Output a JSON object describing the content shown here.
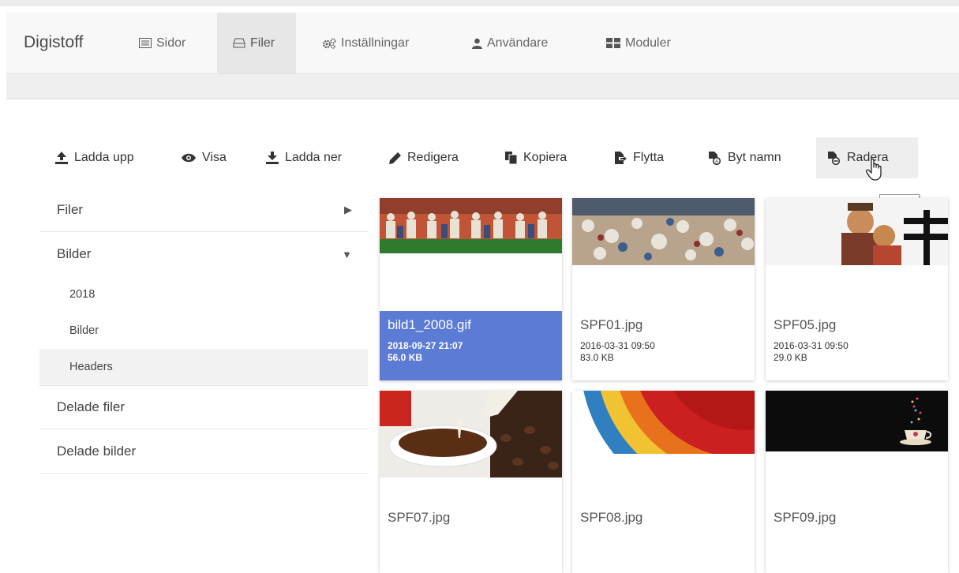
{
  "header": {
    "brand": "Digistoff",
    "nav": [
      {
        "label": "Sidor",
        "icon": "list-icon"
      },
      {
        "label": "Filer",
        "icon": "drive-icon"
      },
      {
        "label": "Inställningar",
        "icon": "cogs-icon"
      },
      {
        "label": "Användare",
        "icon": "user-icon"
      },
      {
        "label": "Moduler",
        "icon": "grid-icon"
      }
    ],
    "active_tab": "Filer"
  },
  "toolbar": {
    "items": [
      {
        "label": "Ladda upp",
        "icon": "upload-icon"
      },
      {
        "label": "Visa",
        "icon": "eye-icon"
      },
      {
        "label": "Ladda ner",
        "icon": "download-icon"
      },
      {
        "label": "Redigera",
        "icon": "pencil-icon"
      },
      {
        "label": "Kopiera",
        "icon": "copy-icon"
      },
      {
        "label": "Flytta",
        "icon": "move-icon"
      },
      {
        "label": "Byt namn",
        "icon": "rename-icon"
      },
      {
        "label": "Radera",
        "icon": "delete-icon"
      }
    ],
    "tooltip": "Radera"
  },
  "sidebar": {
    "items": [
      {
        "label": "Filer"
      },
      {
        "label": "Bilder"
      },
      {
        "label": "Delade filer"
      },
      {
        "label": "Delade bilder"
      }
    ],
    "bilder_children": [
      "2018",
      "Bilder",
      "Headers"
    ],
    "active_child": "Headers"
  },
  "files": [
    {
      "name": "bild1_2008.gif",
      "date": "2018-09-27 21:07",
      "size": "56.0 KB",
      "selected": true
    },
    {
      "name": "SPF01.jpg",
      "date": "2016-03-31 09:50",
      "size": "83.0 KB"
    },
    {
      "name": "SPF05.jpg",
      "date": "2016-03-31 09:50",
      "size": "29.0 KB"
    },
    {
      "name": "SPF07.jpg"
    },
    {
      "name": "SPF08.jpg"
    },
    {
      "name": "SPF09.jpg"
    }
  ],
  "colors": {
    "selected": "#5b7bd5",
    "navbar": "#f8f8f8",
    "active_tab": "#e7e7e7"
  }
}
